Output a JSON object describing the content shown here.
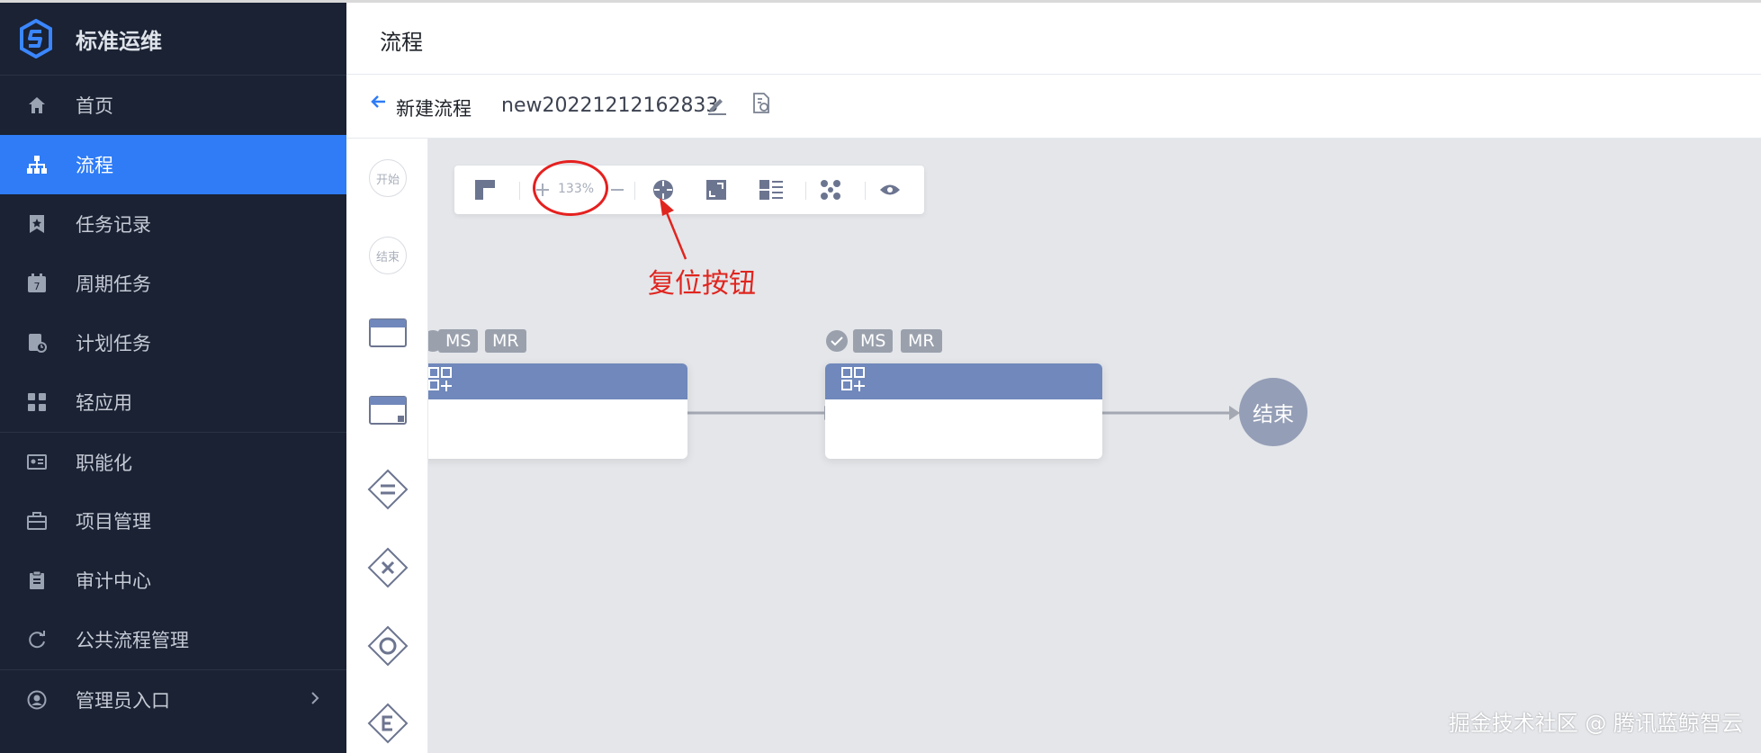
{
  "app": {
    "title": "标准运维",
    "logo_icon": "logo-s-icon",
    "accent": "#2f7cf6"
  },
  "sidebar": {
    "items": [
      {
        "label": "首页",
        "icon": "home-icon"
      },
      {
        "label": "流程",
        "icon": "sitemap-icon",
        "active": true
      },
      {
        "label": "任务记录",
        "icon": "bookmark-star-icon"
      },
      {
        "label": "周期任务",
        "icon": "calendar-icon"
      },
      {
        "label": "计划任务",
        "icon": "plan-clock-icon"
      },
      {
        "label": "轻应用",
        "icon": "grid-apps-icon"
      },
      {
        "label": "职能化",
        "icon": "id-card-icon"
      },
      {
        "label": "项目管理",
        "icon": "briefcase-icon"
      },
      {
        "label": "审计中心",
        "icon": "clipboard-icon"
      },
      {
        "label": "公共流程管理",
        "icon": "refresh-icon"
      },
      {
        "label": "管理员入口",
        "icon": "user-circle-icon"
      }
    ]
  },
  "header": {
    "title": "流程"
  },
  "subbar": {
    "back_label": "新建流程",
    "flow_name": "new20221212162833"
  },
  "palette": {
    "start_label": "开始",
    "end_label": "结束"
  },
  "toolbar": {
    "zoom": "133%"
  },
  "annotation": {
    "text": "复位按钮",
    "color": "#e0251f"
  },
  "canvas": {
    "node_badges": [
      "MS",
      "MR"
    ],
    "end_node_label": "结束"
  },
  "watermark": "掘金技术社区 @ 腾讯蓝鲸智云"
}
